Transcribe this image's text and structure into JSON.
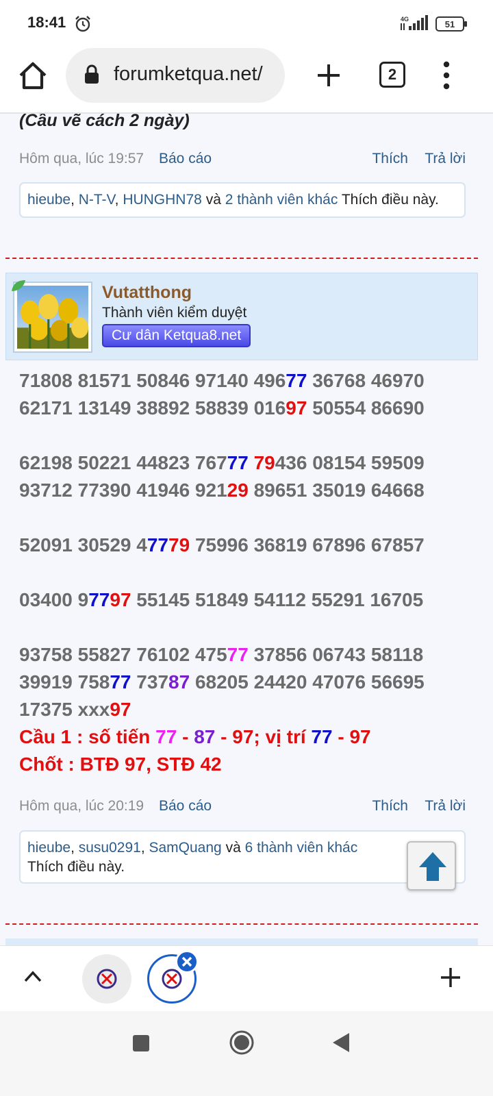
{
  "status_bar": {
    "time": "18:41",
    "network": "4G",
    "battery": "51"
  },
  "browser": {
    "url": "forumketqua.net/",
    "tab_count": "2"
  },
  "previous_post": {
    "title": "(Cầu vẽ cách 2 ngày)",
    "time": "Hôm qua, lúc 19:57",
    "report": "Báo cáo",
    "like": "Thích",
    "reply": "Trả lời",
    "likers": [
      "hieube",
      "N-T-V",
      "HUNGHN78"
    ],
    "and": "và",
    "others": "2 thành viên khác",
    "likes_this": "Thích điều này."
  },
  "post": {
    "username": "Vutatthong",
    "role": "Thành viên kiểm duyệt",
    "badge": "Cư dân Ketqua8.net",
    "summary_line1": {
      "a": "Cầu 1 : số tiến ",
      "b": "77",
      "c": " - ",
      "d": "87",
      "e": " - 97; vị trí ",
      "f": "77",
      "g": " - 97"
    },
    "summary_line2": "Chốt : BTĐ 97, STĐ 42",
    "time": "Hôm qua, lúc 20:19",
    "report": "Báo cáo",
    "like": "Thích",
    "reply": "Trả lời",
    "likers": [
      "hieube",
      "susu0291",
      "SamQuang"
    ],
    "and": "và",
    "others": "6 thành viên khác",
    "likes_this": "Thích điều này."
  },
  "number_lines": [
    [
      [
        "71808 81571 50846 97140 496",
        "g"
      ],
      [
        "77",
        "blue"
      ],
      [
        " 36768 46970",
        "g"
      ]
    ],
    [
      [
        "62171 13149 38892 58839 016",
        "g"
      ],
      [
        "97",
        "red"
      ],
      [
        " 50554 86690",
        "g"
      ]
    ],
    [],
    [
      [
        "62198 50221 44823 767",
        "g"
      ],
      [
        "77",
        "blue"
      ],
      [
        " ",
        "g"
      ],
      [
        "79",
        "red"
      ],
      [
        "436 08154 59509",
        "g"
      ]
    ],
    [
      [
        "93712 77390 41946 921",
        "g"
      ],
      [
        "29",
        "red"
      ],
      [
        " 89651 35019 64668",
        "g"
      ]
    ],
    [],
    [
      [
        "52091 30529 4",
        "g"
      ],
      [
        "77",
        "blue"
      ],
      [
        "79",
        "red"
      ],
      [
        " 75996 36819 67896 67857",
        "g"
      ]
    ],
    [],
    [
      [
        "03400 9",
        "g"
      ],
      [
        "77",
        "blue"
      ],
      [
        "97",
        "red"
      ],
      [
        " 55145 51849 54112 55291 16705",
        "g"
      ]
    ],
    [],
    [
      [
        "93758 55827 76102 475",
        "g"
      ],
      [
        "77",
        "pink"
      ],
      [
        " 37856 06743 58118",
        "g"
      ]
    ],
    [
      [
        "39919 758",
        "g"
      ],
      [
        "77",
        "blue"
      ],
      [
        " 737",
        "g"
      ],
      [
        "87",
        "purple"
      ],
      [
        " 68205 24420 47076 56695",
        "g"
      ]
    ],
    [
      [
        "17375 xxx",
        "g"
      ],
      [
        "97",
        "red"
      ]
    ]
  ],
  "colors": {
    "blue": "#1010c8",
    "red": "#e01010",
    "pink": "#ee22ee",
    "purple": "#7a1fcf",
    "gray": "#6b6b6b",
    "link": "#2b5c8a"
  }
}
